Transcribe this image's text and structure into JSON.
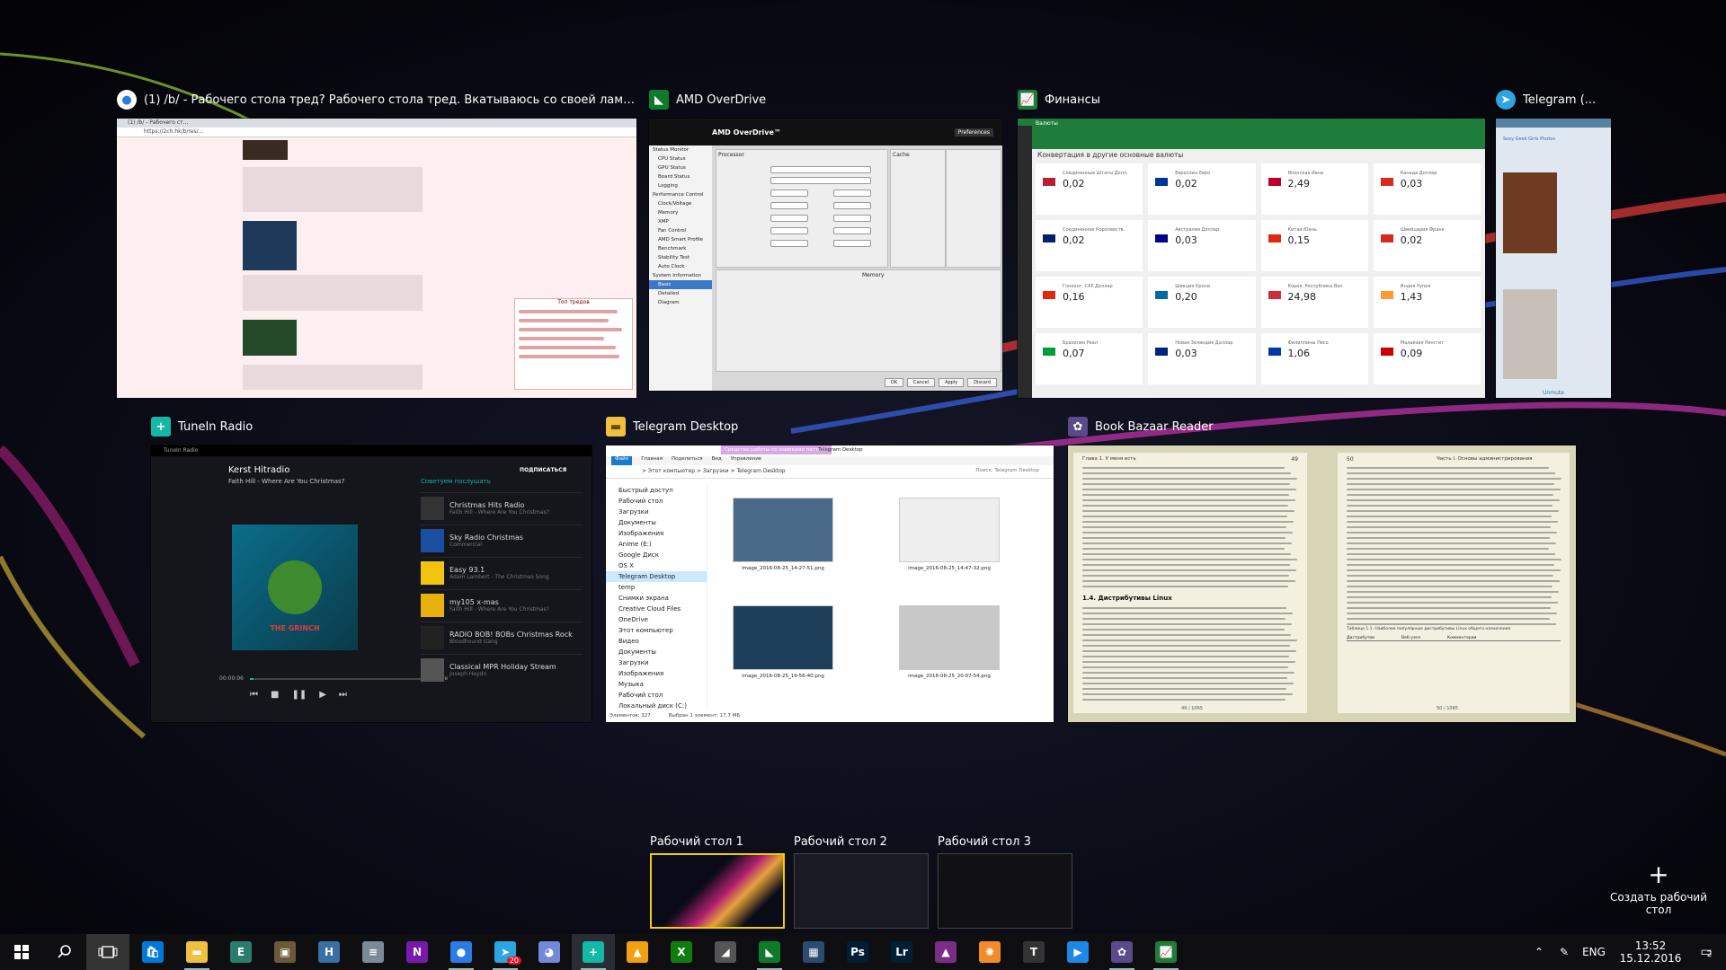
{
  "windows": [
    {
      "title": "(1) /b/ - Рабочего стола тред? Рабочего стола тред. Вкатываюсь со своей ламповой семероч...",
      "icon": "chrome-icon"
    },
    {
      "title": "AMD OverDrive",
      "icon": "amd-icon"
    },
    {
      "title": "Финансы",
      "icon": "finance-icon"
    },
    {
      "title": "Telegram (...",
      "icon": "telegram-icon"
    },
    {
      "title": "TuneIn Radio",
      "icon": "tunein-icon"
    },
    {
      "title": "Telegram Desktop",
      "icon": "folder-icon"
    },
    {
      "title": "Book Bazaar Reader",
      "icon": "book-bazaar-icon"
    }
  ],
  "finance": {
    "header": "Валюты",
    "subtitle": "Конвертация в другие основные валюты",
    "tiles": [
      {
        "name": "Соединенные Штаты Долл.",
        "value": "0,02"
      },
      {
        "name": "Евросоюз Евро",
        "value": "0,02"
      },
      {
        "name": "Японская Иена",
        "value": "2,49"
      },
      {
        "name": "Канада Доллар",
        "value": "0,03"
      },
      {
        "name": "Соединенное Королевств.",
        "value": "0,02"
      },
      {
        "name": "Австралия Доллар",
        "value": "0,03"
      },
      {
        "name": "Китай Юань",
        "value": "0,15"
      },
      {
        "name": "Швейцария Франк",
        "value": "0,02"
      },
      {
        "name": "Гонконг, САР Доллар",
        "value": "0,16"
      },
      {
        "name": "Швеция Крона",
        "value": "0,20"
      },
      {
        "name": "Корея, Республика Вон",
        "value": "24,98"
      },
      {
        "name": "Индия Рупия",
        "value": "1,43"
      },
      {
        "name": "Бразилия Реал",
        "value": "0,07"
      },
      {
        "name": "Новая Зеландия Доллар",
        "value": "0,03"
      },
      {
        "name": "Филиппины Песо",
        "value": "1,06"
      },
      {
        "name": "Малайзия Ринггит",
        "value": "0,09"
      }
    ]
  },
  "amd": {
    "title": "AMD OverDrive™",
    "preferences": "Preferences",
    "processor_label": "Processor",
    "cache_label": "Cache",
    "memory_label": "Memory",
    "tree": [
      "Status Monitor",
      "CPU Status",
      "GPU Status",
      "Board Status",
      "Logging",
      "Performance Control",
      "Clock/Voltage",
      "Memory",
      "XMP",
      "Fan Control",
      "AMD Smart Profile",
      "Benchmark",
      "Stability Test",
      "Auto Clock",
      "System Information",
      "Basic",
      "Detailed",
      "Diagram"
    ],
    "buttons": [
      "OK",
      "Cancel",
      "Apply",
      "Discard"
    ]
  },
  "chrome": {
    "tab": "(1) /b/ - Рабочего ст...",
    "url": "https://2ch.hk/b/res/...",
    "thread_title": "Топ тредов"
  },
  "telegram_mobile": {
    "channel": "Sexy Geek Girls Photos",
    "footer": "Unmute"
  },
  "tunein": {
    "app": "TuneIn Radio",
    "station": "Kerst Hitradio",
    "track": "Faith Hill - Where Are You Christmas?",
    "subscribe": "ПОДПИСАТЬСЯ",
    "recommend": "Советуем послушать",
    "time": "00:00:06",
    "live": "Live",
    "album_title": "THE GRINCH",
    "stations": [
      {
        "name": "Christmas Hits Radio",
        "sub": "Faith Hill - Where Are You Christmas?",
        "color": "#333"
      },
      {
        "name": "Sky Radio Christmas",
        "sub": "Commercial",
        "color": "#1a4fa0"
      },
      {
        "name": "Easy 93.1",
        "sub": "Adam Lambert - The Christmas Song",
        "color": "#f2c40f"
      },
      {
        "name": "my105 x-mas",
        "sub": "Faith Hill - Where Are You Christmas?",
        "color": "#e8b00c"
      },
      {
        "name": "RADIO BOB! BOBs Christmas Rock",
        "sub": "Bloodhound Gang",
        "color": "#222"
      },
      {
        "name": "Classical MPR Holiday Stream",
        "sub": "Joseph Haydn",
        "color": "#555"
      }
    ]
  },
  "explorer": {
    "ribbon_tab": "Средства работы со снимками паттерн",
    "window_title": "Telegram Desktop",
    "tabs": [
      "Файл",
      "Главная",
      "Поделиться",
      "Вид",
      "Управление"
    ],
    "breadcrumb": "> Этот компьютер > Загрузки > Telegram Desktop",
    "search": "Поиск: Telegram Desktop",
    "nav": [
      "Быстрый доступ",
      "Рабочий стол",
      "Загрузки",
      "Документы",
      "Изображения",
      "Anime (E:)",
      "Google Диск",
      "OS X",
      "Telegram Desktop",
      "temp",
      "Снимки экрана",
      "Creative Cloud Files",
      "OneDrive",
      "Этот компьютер",
      "Видео",
      "Документы",
      "Загрузки",
      "Изображения",
      "Музыка",
      "Рабочий стол",
      "Локальный диск (C:)"
    ],
    "files": [
      "image_2016-08-25_14-27-51.png",
      "image_2016-08-25_14-47-32.png",
      "image_2016-08-25_19-56-40.png",
      "image_2016-08-25_20-07-54.png"
    ],
    "status": "Элементов: 327",
    "status2": "Выбран 1 элемент: 17,7 МБ"
  },
  "book": {
    "header_left": "Глава 1. У меня есть",
    "page_left": "49",
    "header_right": "Часть I. Основы администрирования",
    "page_right": "50",
    "section": "1.4. Дистрибутивы Linux",
    "table_caption": "Таблица 1.1. Наиболее популярные дистрибутивы Linux общего назначения",
    "table_headers": [
      "Дистрибутив",
      "Веб-узел",
      "Комментарии"
    ],
    "footer_left": "49 / 1065",
    "footer_right": "50 / 1065"
  },
  "desktops": [
    {
      "label": "Рабочий стол 1",
      "active": true
    },
    {
      "label": "Рабочий стол 2",
      "active": false
    },
    {
      "label": "Рабочий стол 3",
      "active": false
    }
  ],
  "new_desktop": "Создать рабочий стол",
  "taskbar": {
    "apps": [
      {
        "name": "windows-store-icon",
        "glyph": "🛍",
        "bg": "#0078d7"
      },
      {
        "name": "file-explorer-icon",
        "glyph": "▬",
        "bg": "#f0c040"
      },
      {
        "name": "e-app-icon",
        "glyph": "E",
        "bg": "#2a7c6f"
      },
      {
        "name": "app-dark-icon",
        "glyph": "▣",
        "bg": "#6b5a3a"
      },
      {
        "name": "h-app-icon",
        "glyph": "H",
        "bg": "#3a6ea5"
      },
      {
        "name": "app-storage-icon",
        "glyph": "≡",
        "bg": "#7b8a99"
      },
      {
        "name": "onenote-icon",
        "glyph": "N",
        "bg": "#7719aa"
      },
      {
        "name": "chrome-icon",
        "glyph": "●",
        "bg": "#2b7be4"
      },
      {
        "name": "telegram-icon",
        "glyph": "➤",
        "bg": "#2ca5e0"
      },
      {
        "name": "discord-icon",
        "glyph": "◕",
        "bg": "#7289da"
      },
      {
        "name": "tunein-icon",
        "glyph": "+",
        "bg": "#14b8a6"
      },
      {
        "name": "amd-app-icon",
        "glyph": "▲",
        "bg": "#f0a010"
      },
      {
        "name": "xbox-icon",
        "glyph": "X",
        "bg": "#107c10"
      },
      {
        "name": "performance-icon",
        "glyph": "◢",
        "bg": "#555"
      },
      {
        "name": "amd-overdrive-icon",
        "glyph": "◣",
        "bg": "#0d7a2c"
      },
      {
        "name": "video-editor-icon",
        "glyph": "▦",
        "bg": "#2b4b6f"
      },
      {
        "name": "photoshop-icon",
        "glyph": "Ps",
        "bg": "#001e36"
      },
      {
        "name": "lightroom-icon",
        "glyph": "Lr",
        "bg": "#001e36"
      },
      {
        "name": "affinity-icon",
        "glyph": "▲",
        "bg": "#7a2c86"
      },
      {
        "name": "orange-app-icon",
        "glyph": "✺",
        "bg": "#f08d2a"
      },
      {
        "name": "typora-icon",
        "glyph": "T",
        "bg": "#333"
      },
      {
        "name": "play-icon",
        "glyph": "▶",
        "bg": "#1e88e5"
      },
      {
        "name": "book-bazaar-icon",
        "glyph": "✿",
        "bg": "#5b4a8a"
      },
      {
        "name": "finance-app-icon",
        "glyph": "📈",
        "bg": "#1e7d3a"
      }
    ],
    "telegram_badge": "20",
    "language": "ENG",
    "time": "13:52",
    "date": "15.12.2016",
    "notifications": "2"
  }
}
